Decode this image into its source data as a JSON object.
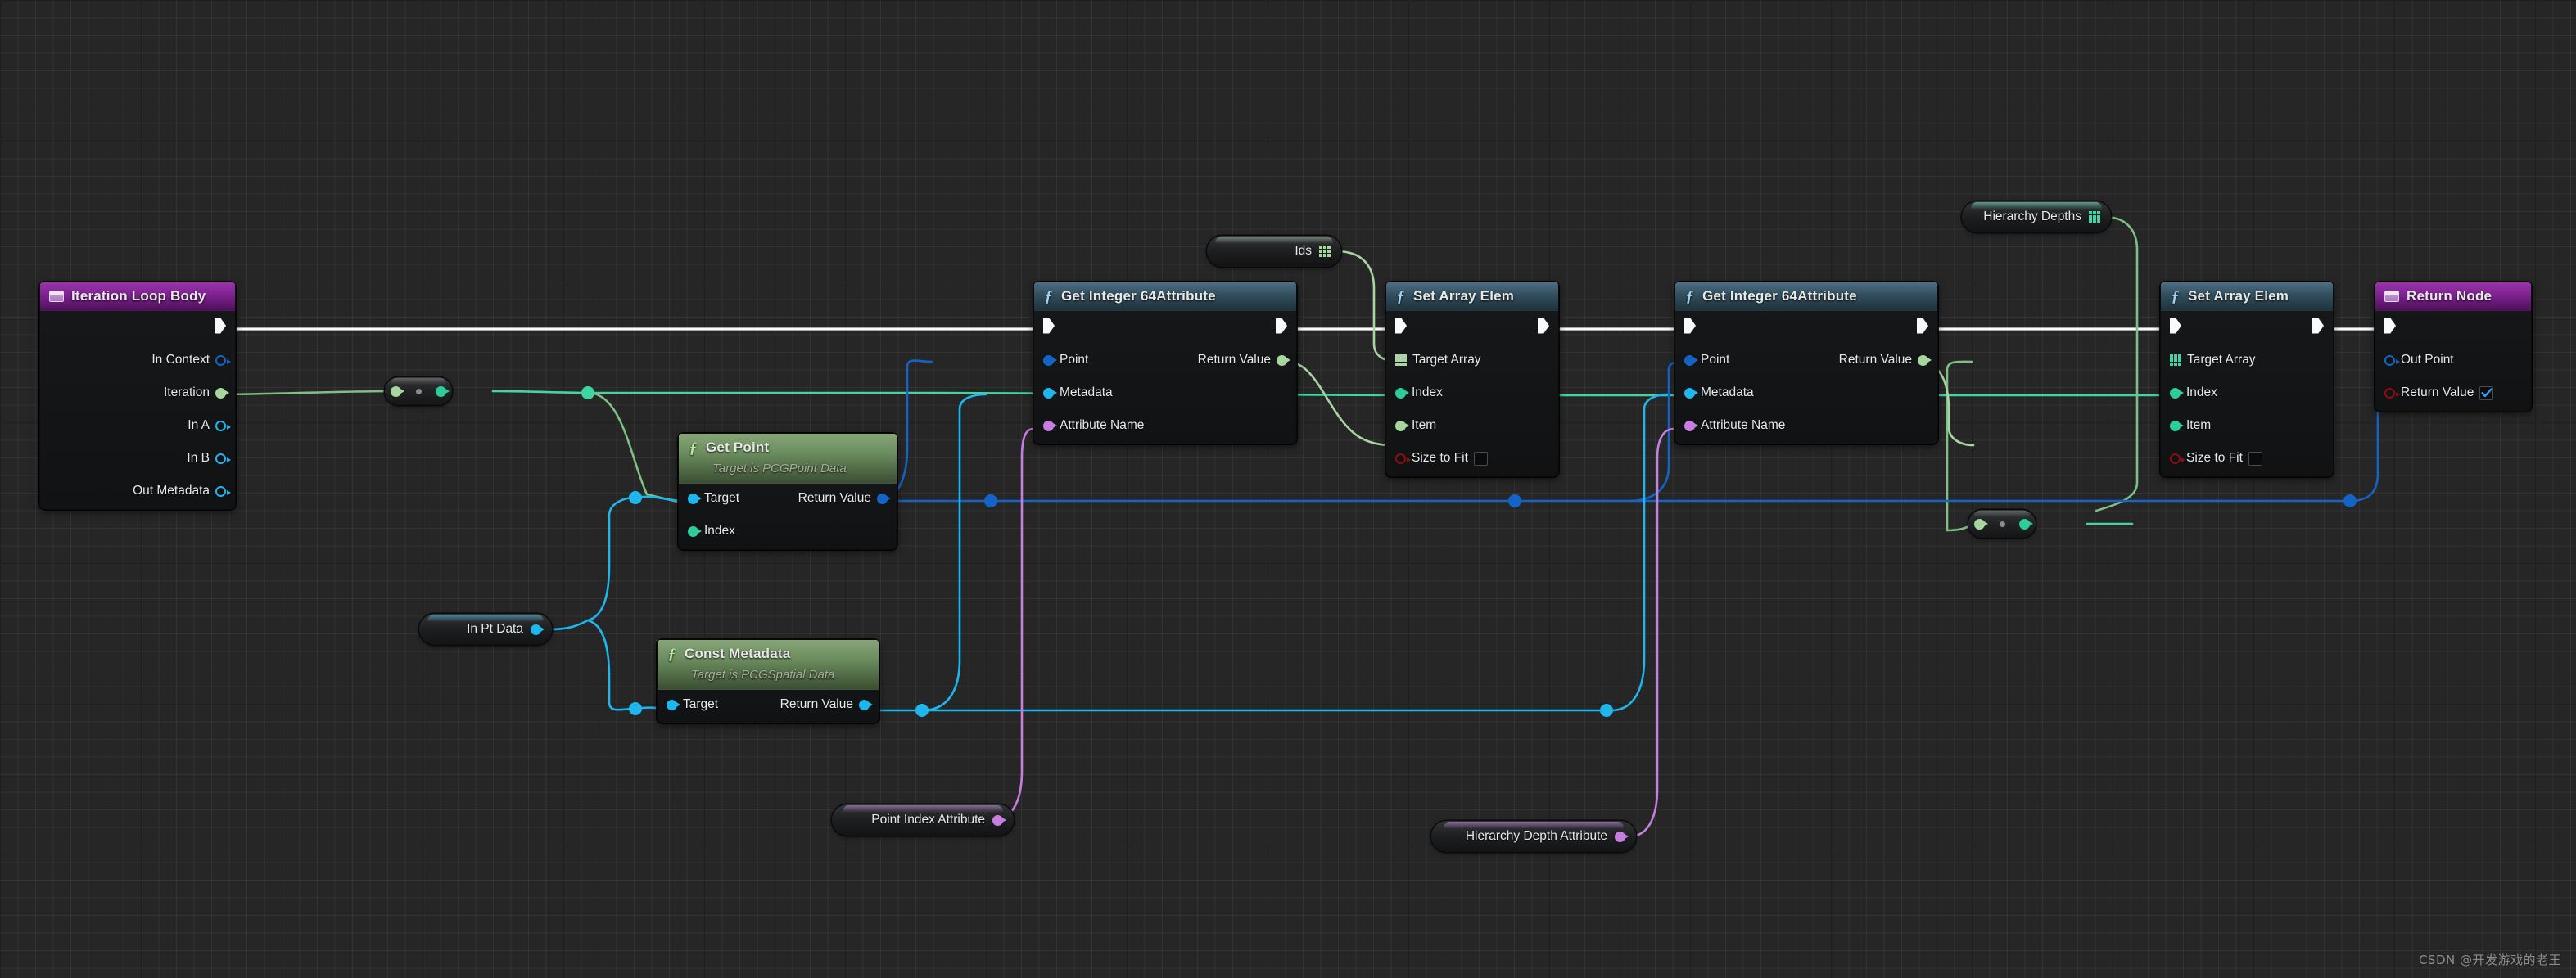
{
  "app": {
    "kind": "unreal-engine-blueprint-graph",
    "watermark": "CSDN @开发游戏的老王",
    "background_color": "#262626"
  },
  "palette": {
    "exec_white": "#fafafa",
    "object_blue": "#1464c8",
    "pcg_cyan": "#1fb6ee",
    "int64_lightgreen": "#a7d6a0",
    "int_green": "#2ecc9b",
    "name_purple": "#c87ee0",
    "bool_red": "#8f0d12",
    "array_mint": "#3fd6a4",
    "wire_green": "#7fbf86",
    "header_event_purple": "#9b34ad",
    "header_func_blue": "#4e6f85",
    "header_func_green": "#86a678"
  },
  "nodes": [
    {
      "id": "iteration-loop-body",
      "type": "event",
      "title": "Iteration Loop Body",
      "subtitle": "",
      "icon": "event-node-icon",
      "pins": [
        {
          "label": "",
          "kind": "exec",
          "side": "out"
        },
        {
          "label": "In Context",
          "kind": "object",
          "side": "out"
        },
        {
          "label": "Iteration",
          "kind": "int",
          "side": "out"
        },
        {
          "label": "In A",
          "kind": "object",
          "side": "out"
        },
        {
          "label": "In B",
          "kind": "object",
          "side": "out"
        },
        {
          "label": "Out Metadata",
          "kind": "object",
          "side": "out"
        }
      ]
    },
    {
      "id": "get-point",
      "type": "function-green",
      "title": "Get Point",
      "subtitle": "Target is PCGPoint Data",
      "icon": "function-icon",
      "pins": [
        {
          "label": "Target",
          "kind": "pcg",
          "side": "in"
        },
        {
          "label": "Return Value",
          "kind": "object",
          "side": "out"
        },
        {
          "label": "Index",
          "kind": "int",
          "side": "in"
        }
      ]
    },
    {
      "id": "const-metadata",
      "type": "function-green",
      "title": "Const Metadata",
      "subtitle": "Target is PCGSpatial Data",
      "icon": "function-icon",
      "pins": [
        {
          "label": "Target",
          "kind": "pcg",
          "side": "in"
        },
        {
          "label": "Return Value",
          "kind": "pcg",
          "side": "out"
        }
      ]
    },
    {
      "id": "get-integer-64-attribute-1",
      "type": "function-blue",
      "title": "Get Integer 64Attribute",
      "subtitle": "",
      "icon": "function-icon",
      "pins": [
        {
          "label": "",
          "kind": "exec",
          "side": "both"
        },
        {
          "label": "Point",
          "kind": "object",
          "side": "in"
        },
        {
          "label": "Return Value",
          "kind": "int64",
          "side": "out"
        },
        {
          "label": "Metadata",
          "kind": "pcg",
          "side": "in"
        },
        {
          "label": "Attribute Name",
          "kind": "name",
          "side": "in"
        }
      ]
    },
    {
      "id": "set-array-elem-1",
      "type": "function-blue",
      "title": "Set Array Elem",
      "subtitle": "",
      "icon": "function-icon",
      "pins": [
        {
          "label": "",
          "kind": "exec",
          "side": "both"
        },
        {
          "label": "Target Array",
          "kind": "array",
          "side": "in"
        },
        {
          "label": "Index",
          "kind": "int",
          "side": "in"
        },
        {
          "label": "Item",
          "kind": "int64",
          "side": "in"
        },
        {
          "label": "Size to Fit",
          "kind": "bool",
          "side": "in",
          "value": false
        }
      ]
    },
    {
      "id": "get-integer-64-attribute-2",
      "type": "function-blue",
      "title": "Get Integer 64Attribute",
      "subtitle": "",
      "icon": "function-icon",
      "pins": [
        {
          "label": "",
          "kind": "exec",
          "side": "both"
        },
        {
          "label": "Point",
          "kind": "object",
          "side": "in"
        },
        {
          "label": "Return Value",
          "kind": "int64",
          "side": "out"
        },
        {
          "label": "Metadata",
          "kind": "pcg",
          "side": "in"
        },
        {
          "label": "Attribute Name",
          "kind": "name",
          "side": "in"
        }
      ]
    },
    {
      "id": "set-array-elem-2",
      "type": "function-blue",
      "title": "Set Array Elem",
      "subtitle": "",
      "icon": "function-icon",
      "pins": [
        {
          "label": "",
          "kind": "exec",
          "side": "both"
        },
        {
          "label": "Target Array",
          "kind": "array",
          "side": "in"
        },
        {
          "label": "Index",
          "kind": "int",
          "side": "in"
        },
        {
          "label": "Item",
          "kind": "int",
          "side": "in"
        },
        {
          "label": "Size to Fit",
          "kind": "bool",
          "side": "in",
          "value": false
        }
      ]
    },
    {
      "id": "return-node",
      "type": "event",
      "title": "Return Node",
      "subtitle": "",
      "icon": "event-node-icon",
      "pins": [
        {
          "label": "",
          "kind": "exec",
          "side": "in"
        },
        {
          "label": "Out Point",
          "kind": "object-hollow",
          "side": "in"
        },
        {
          "label": "Return Value",
          "kind": "bool",
          "side": "in",
          "value": true
        }
      ]
    }
  ],
  "variable_nodes": [
    {
      "id": "ids",
      "label": "Ids",
      "pin": "array",
      "color": "#a7d6a0"
    },
    {
      "id": "hierarchy-depths",
      "label": "Hierarchy Depths",
      "pin": "array",
      "color": "#3fd6a4"
    },
    {
      "id": "in-pt-data",
      "label": "In Pt Data",
      "pin": "object",
      "color": "#1fb6ee"
    },
    {
      "id": "point-index-attribute",
      "label": "Point Index Attribute",
      "pin": "name",
      "color": "#c87ee0"
    },
    {
      "id": "hierarchy-depth-attribute",
      "label": "Hierarchy Depth Attribute",
      "pin": "name",
      "color": "#c87ee0"
    }
  ],
  "labels": {
    "iteration_loop_body": "Iteration Loop Body",
    "in_context": "In Context",
    "iteration": "Iteration",
    "in_a": "In A",
    "in_b": "In B",
    "out_metadata": "Out Metadata",
    "get_point": "Get Point",
    "get_point_sub": "Target is PCGPoint Data",
    "const_metadata": "Const Metadata",
    "const_metadata_sub": "Target is PCGSpatial Data",
    "target": "Target",
    "index": "Index",
    "return_value": "Return Value",
    "get_integer_64_attribute": "Get Integer 64Attribute",
    "point": "Point",
    "metadata": "Metadata",
    "attribute_name": "Attribute Name",
    "set_array_elem": "Set Array Elem",
    "target_array": "Target Array",
    "item": "Item",
    "size_to_fit": "Size to Fit",
    "return_node": "Return Node",
    "out_point": "Out Point",
    "ids": "Ids",
    "hierarchy_depths": "Hierarchy Depths",
    "in_pt_data": "In Pt Data",
    "point_index_attribute": "Point Index Attribute",
    "hierarchy_depth_attribute": "Hierarchy Depth Attribute"
  }
}
